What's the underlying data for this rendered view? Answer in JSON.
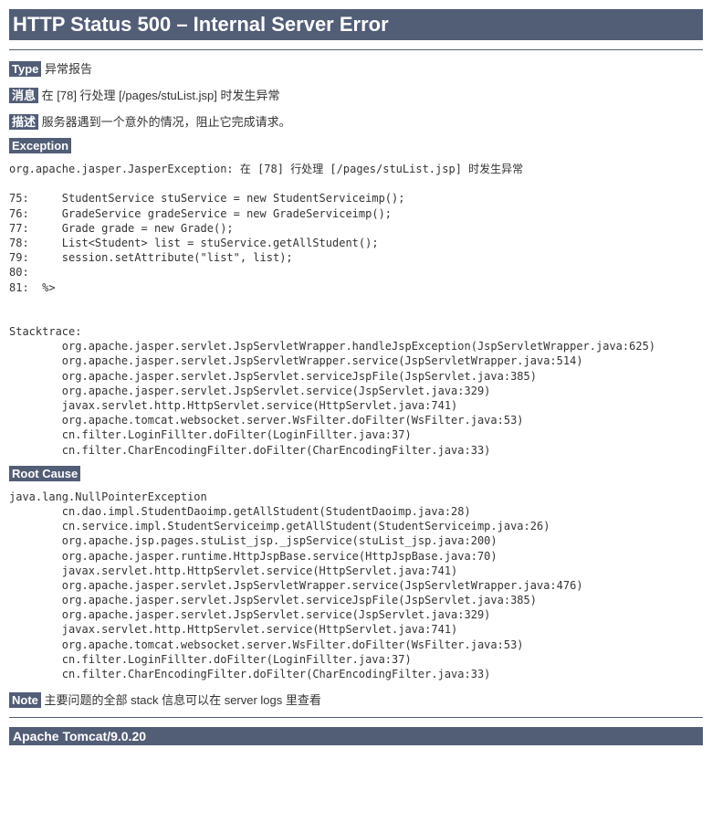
{
  "header": {
    "title": "HTTP Status 500 – Internal Server Error"
  },
  "labels": {
    "type": "Type",
    "message": "消息",
    "description": "描述",
    "exception": "Exception",
    "rootCause": "Root Cause",
    "note": "Note"
  },
  "values": {
    "type": "异常报告",
    "message": "在 [78] 行处理 [/pages/stuList.jsp] 时发生异常",
    "description": "服务器遇到一个意外的情况，阻止它完成请求。",
    "note": "主要问题的全部 stack 信息可以在 server logs 里查看"
  },
  "exception": {
    "text": "org.apache.jasper.JasperException: 在 [78] 行处理 [/pages/stuList.jsp] 时发生异常\n\n75:     StudentService stuService = new StudentServiceimp();\n76:     GradeService gradeService = new GradeServiceimp();\n77:     Grade grade = new Grade();\n78:     List<Student> list = stuService.getAllStudent();\n79:     session.setAttribute(\"list\", list);\n80: \n81:  %>\n\n\nStacktrace:\n\torg.apache.jasper.servlet.JspServletWrapper.handleJspException(JspServletWrapper.java:625)\n\torg.apache.jasper.servlet.JspServletWrapper.service(JspServletWrapper.java:514)\n\torg.apache.jasper.servlet.JspServlet.serviceJspFile(JspServlet.java:385)\n\torg.apache.jasper.servlet.JspServlet.service(JspServlet.java:329)\n\tjavax.servlet.http.HttpServlet.service(HttpServlet.java:741)\n\torg.apache.tomcat.websocket.server.WsFilter.doFilter(WsFilter.java:53)\n\tcn.filter.LoginFillter.doFilter(LoginFillter.java:37)\n\tcn.filter.CharEncodingFilter.doFilter(CharEncodingFilter.java:33)"
  },
  "rootCause": {
    "text": "java.lang.NullPointerException\n\tcn.dao.impl.StudentDaoimp.getAllStudent(StudentDaoimp.java:28)\n\tcn.service.impl.StudentServiceimp.getAllStudent(StudentServiceimp.java:26)\n\torg.apache.jsp.pages.stuList_jsp._jspService(stuList_jsp.java:200)\n\torg.apache.jasper.runtime.HttpJspBase.service(HttpJspBase.java:70)\n\tjavax.servlet.http.HttpServlet.service(HttpServlet.java:741)\n\torg.apache.jasper.servlet.JspServletWrapper.service(JspServletWrapper.java:476)\n\torg.apache.jasper.servlet.JspServlet.serviceJspFile(JspServlet.java:385)\n\torg.apache.jasper.servlet.JspServlet.service(JspServlet.java:329)\n\tjavax.servlet.http.HttpServlet.service(HttpServlet.java:741)\n\torg.apache.tomcat.websocket.server.WsFilter.doFilter(WsFilter.java:53)\n\tcn.filter.LoginFillter.doFilter(LoginFillter.java:37)\n\tcn.filter.CharEncodingFilter.doFilter(CharEncodingFilter.java:33)"
  },
  "footer": {
    "server": "Apache Tomcat/9.0.20"
  }
}
